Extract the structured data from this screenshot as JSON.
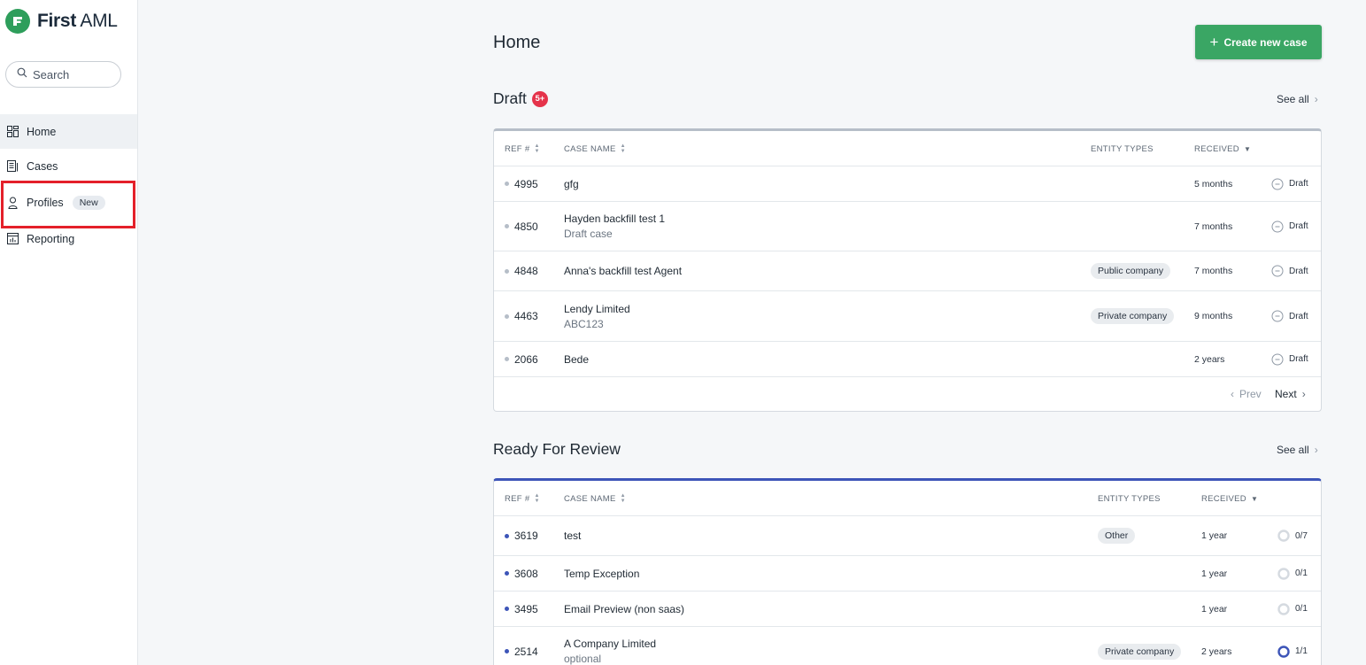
{
  "brand": {
    "name_bold": "First",
    "name_light": " AML"
  },
  "search": {
    "placeholder": "Search"
  },
  "nav": {
    "home": "Home",
    "cases": "Cases",
    "profiles": "Profiles",
    "profiles_badge": "New",
    "reporting": "Reporting"
  },
  "page": {
    "title": "Home",
    "create_label": "Create new case"
  },
  "draft": {
    "title": "Draft",
    "count_badge": "5+",
    "see_all": "See all",
    "headers": {
      "ref": "REF #",
      "name": "CASE NAME",
      "entity": "ENTITY TYPES",
      "received": "RECEIVED"
    },
    "rows": [
      {
        "ref": "4995",
        "name": "gfg",
        "sub": "",
        "entity": "",
        "received": "5 months",
        "status": "Draft"
      },
      {
        "ref": "4850",
        "name": "Hayden backfill test 1",
        "sub": "Draft case",
        "entity": "",
        "received": "7 months",
        "status": "Draft"
      },
      {
        "ref": "4848",
        "name": "Anna's backfill test Agent",
        "sub": "",
        "entity": "Public company",
        "received": "7 months",
        "status": "Draft"
      },
      {
        "ref": "4463",
        "name": "Lendy Limited",
        "sub": "ABC123",
        "entity": "Private company",
        "received": "9 months",
        "status": "Draft"
      },
      {
        "ref": "2066",
        "name": "Bede",
        "sub": "",
        "entity": "",
        "received": "2 years",
        "status": "Draft"
      }
    ],
    "pager": {
      "prev": "Prev",
      "next": "Next"
    }
  },
  "review": {
    "title": "Ready For Review",
    "see_all": "See all",
    "headers": {
      "ref": "REF #",
      "name": "CASE NAME",
      "entity": "ENTITY TYPES",
      "received": "RECEIVED"
    },
    "rows": [
      {
        "ref": "3619",
        "name": "test",
        "sub": "",
        "entity": "Other",
        "received": "1 year",
        "progress": "0/7"
      },
      {
        "ref": "3608",
        "name": "Temp Exception",
        "sub": "",
        "entity": "",
        "received": "1 year",
        "progress": "0/1"
      },
      {
        "ref": "3495",
        "name": "Email Preview (non saas)",
        "sub": "",
        "entity": "",
        "received": "1 year",
        "progress": "0/1"
      },
      {
        "ref": "2514",
        "name": "A Company Limited",
        "sub": "optional",
        "entity": "Private company",
        "received": "2 years",
        "progress": "1/1"
      }
    ]
  },
  "colors": {
    "brand_green": "#3aa664",
    "badge_red": "#e5334b",
    "review_blue": "#3d55b8",
    "draft_gray": "#b6bec8",
    "highlight_red": "#e4202a"
  }
}
